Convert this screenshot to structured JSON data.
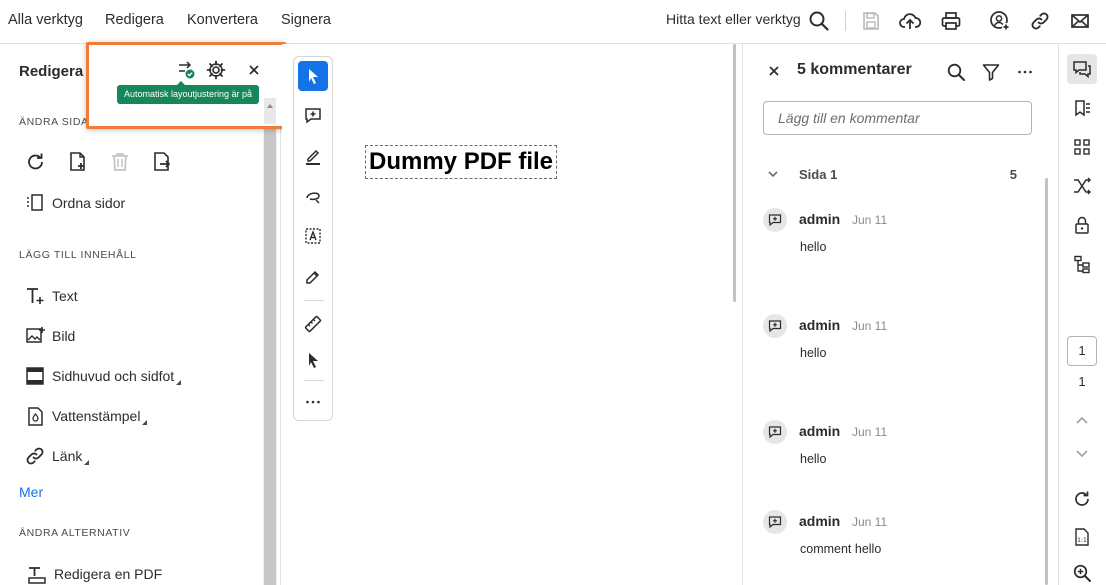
{
  "topbar": {
    "tabs": [
      {
        "label": "Alla verktyg",
        "active": false
      },
      {
        "label": "Redigera",
        "active": true
      },
      {
        "label": "Konvertera",
        "active": false
      },
      {
        "label": "Signera",
        "active": false
      }
    ],
    "find_label": "Hitta text eller verktyg",
    "icons": [
      "search-icon",
      "save-icon",
      "cloud-upload-icon",
      "print-icon",
      "share-user-icon",
      "link-icon",
      "mail-icon"
    ]
  },
  "left_panel": {
    "title": "Redigera",
    "popup_tooltip": "Automatisk layoutjustering är på",
    "section_pages": "ÄNDRA SIDA",
    "organize_label": "Ordna sidor",
    "section_add": "LÄGG TILL INNEHÅLL",
    "items": [
      {
        "label": "Text",
        "icon": "add-text-icon"
      },
      {
        "label": "Bild",
        "icon": "add-image-icon"
      },
      {
        "label": "Sidhuvud och sidfot",
        "icon": "header-footer-icon"
      },
      {
        "label": "Vattenstämpel",
        "icon": "watermark-icon"
      },
      {
        "label": "Länk",
        "icon": "link-icon"
      }
    ],
    "more_label": "Mer",
    "section_other": "ÄNDRA ALTERNATIV",
    "edit_pdf_label": "Redigera en PDF"
  },
  "document": {
    "title": "Dummy PDF file"
  },
  "comments": {
    "title": "5 kommentarer",
    "input_placeholder": "Lägg till en kommentar",
    "page_label": "Sida 1",
    "page_count": "5",
    "items": [
      {
        "author": "admin",
        "date": "Jun 11",
        "text": "hello"
      },
      {
        "author": "admin",
        "date": "Jun 11",
        "text": "hello"
      },
      {
        "author": "admin",
        "date": "Jun 11",
        "text": "hello"
      },
      {
        "author": "admin",
        "date": "Jun 11",
        "text": "comment hello"
      }
    ]
  },
  "rail": {
    "current_page": "1",
    "total_pages": "1"
  },
  "colors": {
    "accent": "#1473e6",
    "highlight": "#ee7c3b",
    "tooltip": "#16875a"
  }
}
